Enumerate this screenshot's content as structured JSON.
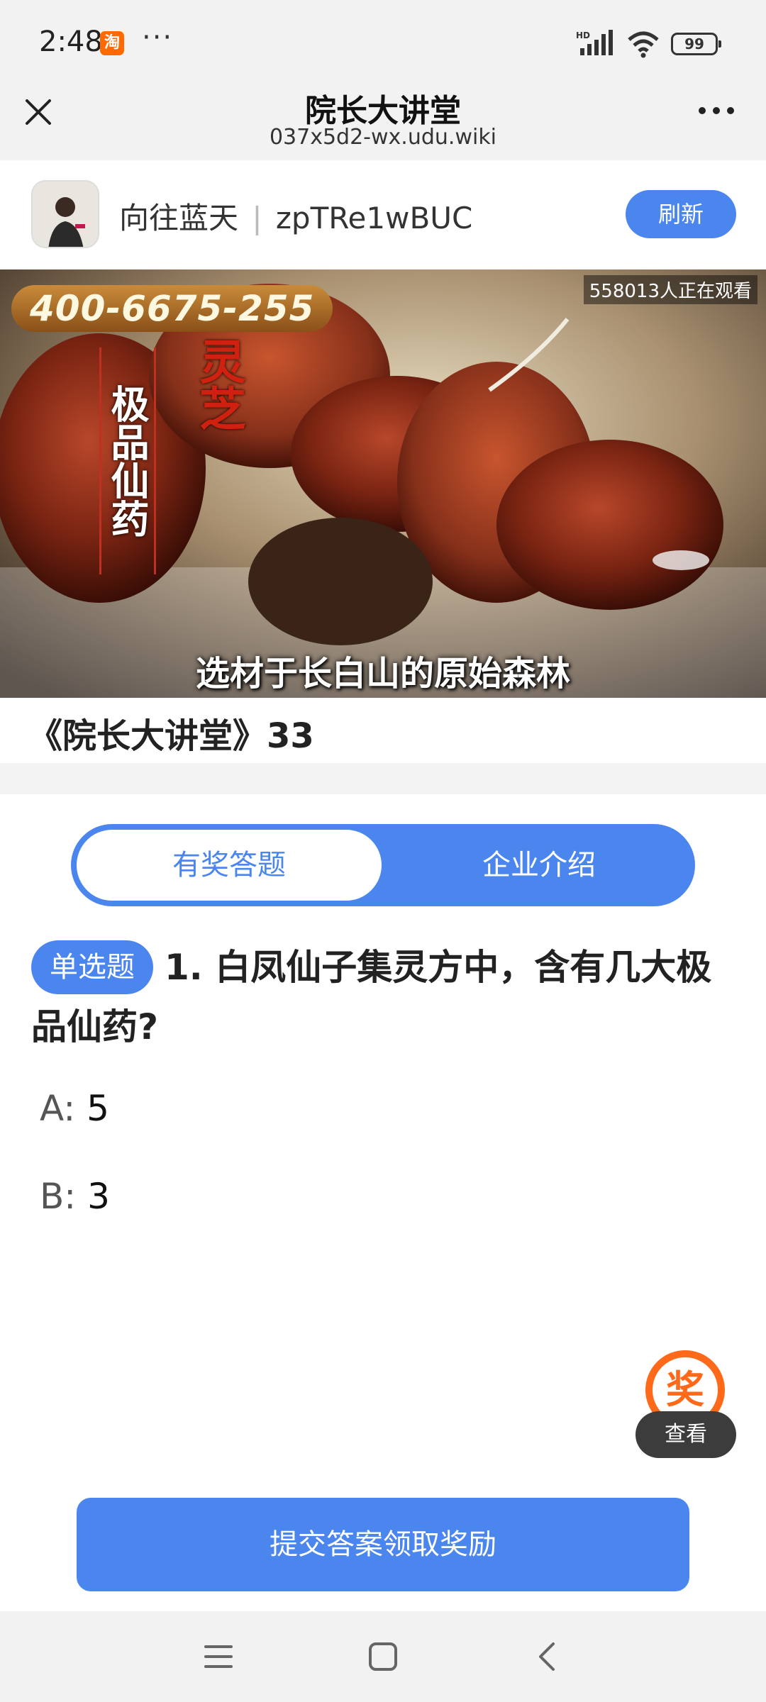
{
  "status_bar": {
    "time": "2:48",
    "app_badge": "淘",
    "more_dots": "···",
    "network_label": "HD",
    "battery": "99"
  },
  "title_bar": {
    "title": "院长大讲堂",
    "url": "037x5d2-wx.udu.wiki"
  },
  "profile": {
    "name": "向往蓝天",
    "id": "zpTRe1wBUC",
    "refresh_label": "刷新"
  },
  "video": {
    "phone": "400-6675-255",
    "viewers": "558013人正在观看",
    "vertical_title": "极品仙药",
    "vertical_brand": "灵芝",
    "caption": "选材于长白山的原始森林"
  },
  "course_title": "《院长大讲堂》33",
  "tabs": [
    {
      "label": "有奖答题",
      "active": true
    },
    {
      "label": "企业介绍",
      "active": false
    }
  ],
  "question": {
    "type_badge": "单选题",
    "text": "1. 白凤仙子集灵方中，含有几大极品仙药?"
  },
  "options": [
    {
      "letter": "A:",
      "value": "5"
    },
    {
      "letter": "B:",
      "value": "3"
    }
  ],
  "reward": {
    "icon_char": "奖",
    "view_label": "查看"
  },
  "submit_label": "提交答案领取奖励",
  "colors": {
    "primary": "#4a86ee",
    "reward_orange": "#ff6a1a"
  }
}
